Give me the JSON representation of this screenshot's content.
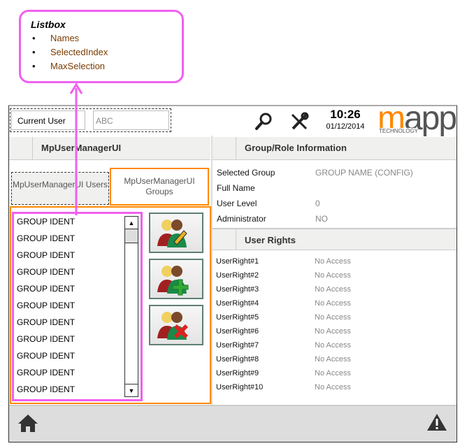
{
  "callout": {
    "title": "Listbox",
    "items": [
      "Names",
      "SelectedIndex",
      "MaxSelection"
    ],
    "color": "#f060f0"
  },
  "header": {
    "current_user_label": "Current User",
    "current_user_value": "ABC",
    "time": "10:26",
    "date": "01/12/2014",
    "logo": "mapp TECHNOLOGY",
    "icons": [
      "search-icon",
      "wrench-icon"
    ]
  },
  "left": {
    "title": "MpUserManagerUI",
    "tab_users": "MpUserManagerUI Users",
    "tab_groups": "MpUserManagerUI Groups",
    "listbox_items": [
      "GROUP IDENT",
      "GROUP IDENT",
      "GROUP IDENT",
      "GROUP IDENT",
      "GROUP IDENT",
      "GROUP IDENT",
      "GROUP IDENT",
      "GROUP IDENT",
      "GROUP IDENT",
      "GROUP IDENT",
      "GROUP IDENT"
    ],
    "buttons": [
      "edit-group-icon",
      "add-group-icon",
      "delete-group-icon"
    ],
    "accent": "#ff8800"
  },
  "right": {
    "title": "Group/Role Information",
    "fields": [
      {
        "label": "Selected Group",
        "value": "GROUP NAME (CONFIG)"
      },
      {
        "label": "Full Name",
        "value": ""
      },
      {
        "label": "User Level",
        "value": "0"
      },
      {
        "label": "Administrator",
        "value": "NO"
      }
    ],
    "rights_title": "User Rights",
    "rights": [
      {
        "label": "UserRight#1",
        "value": "No Access"
      },
      {
        "label": "UserRight#2",
        "value": "No Access"
      },
      {
        "label": "UserRight#3",
        "value": "No Access"
      },
      {
        "label": "UserRight#4",
        "value": "No Access"
      },
      {
        "label": "UserRight#5",
        "value": "No Access"
      },
      {
        "label": "UserRight#6",
        "value": "No Access"
      },
      {
        "label": "UserRight#7",
        "value": "No Access"
      },
      {
        "label": "UserRight#8",
        "value": "No Access"
      },
      {
        "label": "UserRight#9",
        "value": "No Access"
      },
      {
        "label": "UserRight#10",
        "value": "No Access"
      }
    ]
  },
  "footer": {
    "icons": [
      "home-icon",
      "warning-icon"
    ]
  }
}
